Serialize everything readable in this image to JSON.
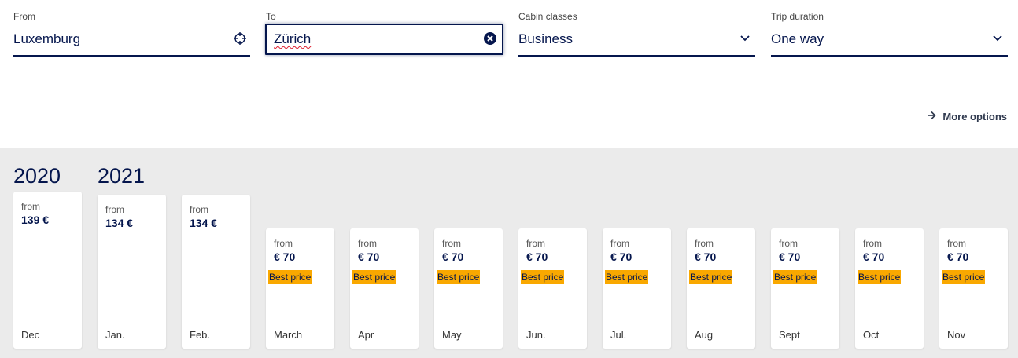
{
  "search": {
    "from": {
      "label": "From",
      "value": "Luxemburg",
      "icon": "crosshair-icon"
    },
    "to": {
      "label": "To",
      "value": "Zürich",
      "icon": "clear-icon"
    },
    "cabin": {
      "label": "Cabin classes",
      "value": "Business",
      "icon": "chevron-down-icon"
    },
    "trip": {
      "label": "Trip duration",
      "value": "One way",
      "icon": "chevron-down-icon"
    }
  },
  "more_options": {
    "label": "More options",
    "icon": "arrow-right-icon"
  },
  "calendar": {
    "years": [
      "2020",
      "2021"
    ],
    "months": [
      {
        "from": "from",
        "price": "139 €",
        "best": "",
        "month": "Dec",
        "tall": true
      },
      {
        "from": "from",
        "price": "134 €",
        "best": "",
        "month": "Jan.",
        "tall": true
      },
      {
        "from": "from",
        "price": "134 €",
        "best": "",
        "month": "Feb.",
        "tall": true
      },
      {
        "from": "from",
        "price": "€ 70",
        "best": "Best price",
        "month": "March",
        "tall": false
      },
      {
        "from": "from",
        "price": "€ 70",
        "best": "Best price",
        "month": "Apr",
        "tall": false
      },
      {
        "from": "from",
        "price": "€ 70",
        "best": "Best price",
        "month": "May",
        "tall": false
      },
      {
        "from": "from",
        "price": "€ 70",
        "best": "Best price",
        "month": "Jun.",
        "tall": false
      },
      {
        "from": "from",
        "price": "€ 70",
        "best": "Best price",
        "month": "Jul.",
        "tall": false
      },
      {
        "from": "from",
        "price": "€ 70",
        "best": "Best price",
        "month": "Aug",
        "tall": false
      },
      {
        "from": "from",
        "price": "€ 70",
        "best": "Best price",
        "month": "Sept",
        "tall": false
      },
      {
        "from": "from",
        "price": "€ 70",
        "best": "Best price",
        "month": "Oct",
        "tall": false
      },
      {
        "from": "from",
        "price": "€ 70",
        "best": "Best price",
        "month": "Nov",
        "tall": false
      }
    ]
  },
  "colors": {
    "brand": "#05164d",
    "accent": "#f9a800",
    "panel": "#ebebeb"
  }
}
